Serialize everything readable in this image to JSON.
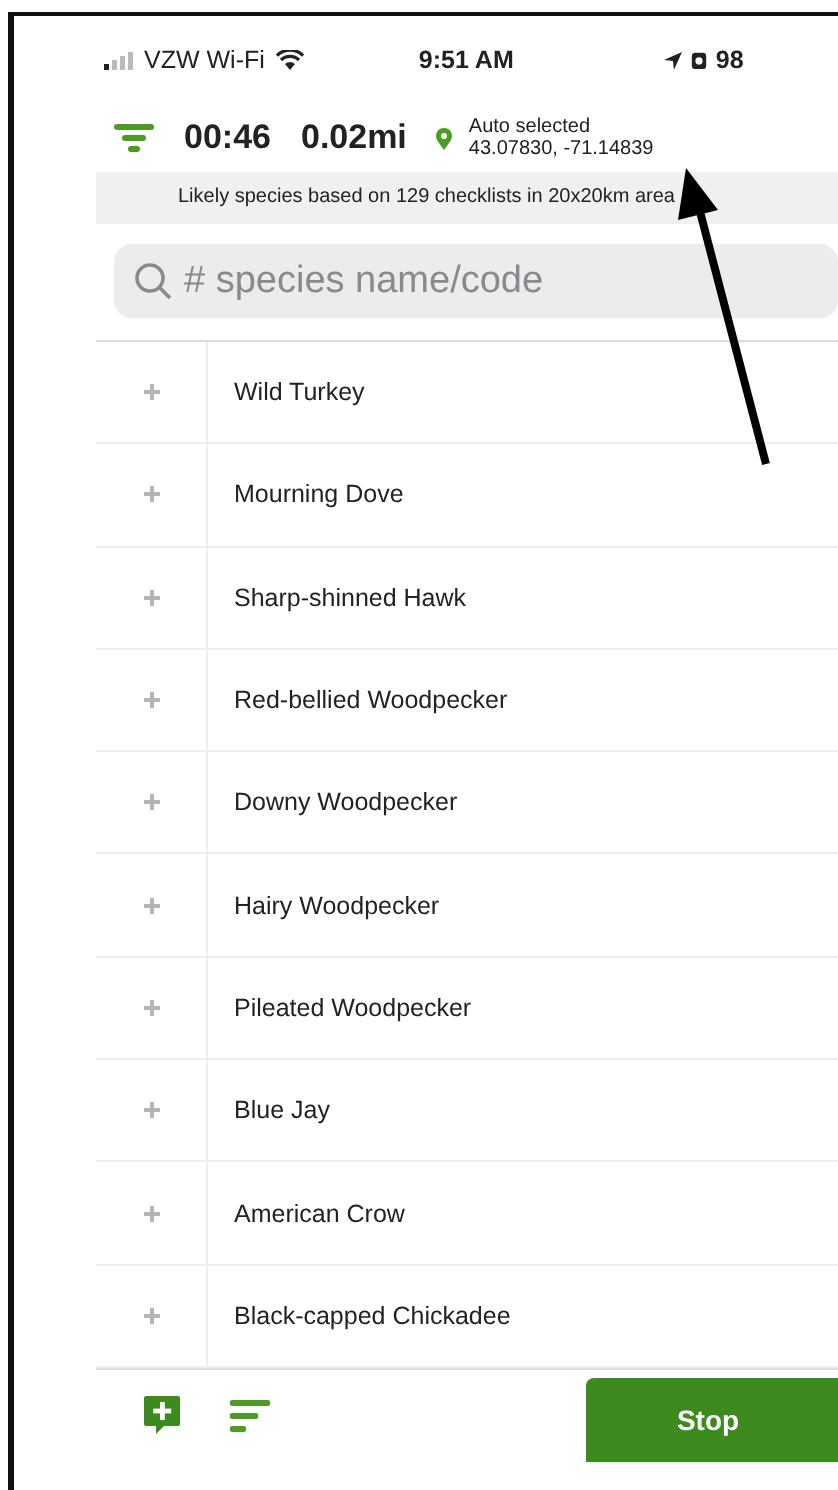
{
  "status_bar": {
    "carrier": "VZW Wi-Fi",
    "time": "9:51 AM",
    "battery": "98"
  },
  "header": {
    "timer": "00:46",
    "distance": "0.02mi",
    "location_label": "Auto selected",
    "coordinates": "43.07830, -71.14839"
  },
  "banner": "Likely species based on 129 checklists in 20x20km area",
  "search": {
    "placeholder": "# species name/code"
  },
  "species": [
    {
      "name": "Wild Turkey"
    },
    {
      "name": "Mourning Dove"
    },
    {
      "name": "Sharp-shinned Hawk"
    },
    {
      "name": "Red-bellied Woodpecker"
    },
    {
      "name": "Downy Woodpecker"
    },
    {
      "name": "Hairy Woodpecker"
    },
    {
      "name": "Pileated Woodpecker"
    },
    {
      "name": "Blue Jay"
    },
    {
      "name": "American Crow"
    },
    {
      "name": "Black-capped Chickadee"
    }
  ],
  "bottom_bar": {
    "stop_label": "Stop"
  }
}
